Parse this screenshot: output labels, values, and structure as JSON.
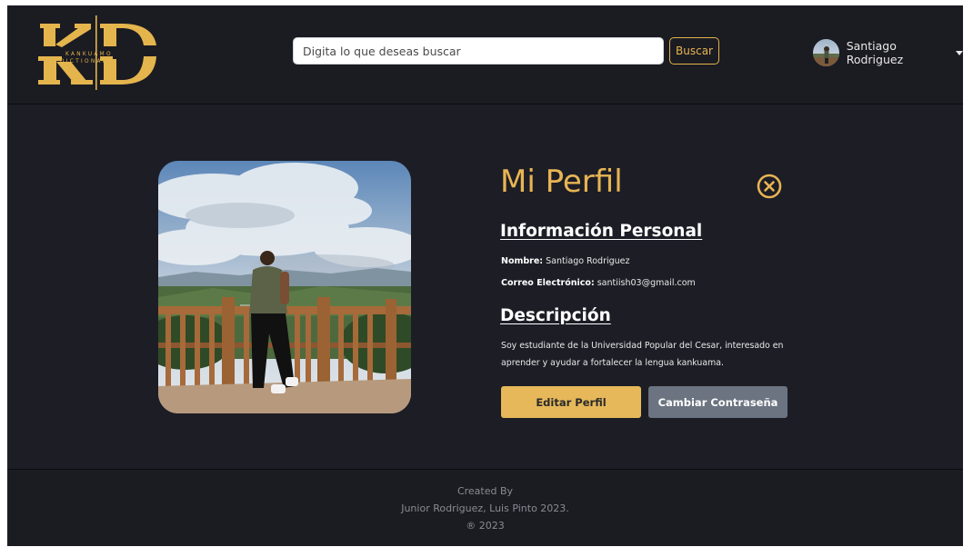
{
  "header": {
    "logo": {
      "top_text": "KANKUAMO",
      "bottom_text": "DICTIONARY",
      "monogram": "KD",
      "color": "#e4b54d"
    },
    "search": {
      "placeholder": "Digita lo que deseas buscar",
      "value": "",
      "button_label": "Buscar"
    },
    "user": {
      "name": "Santiago Rodriguez",
      "avatar_icon": "user-avatar-photo"
    }
  },
  "profile": {
    "title": "Mi Perfil",
    "close_icon": "close-circle-icon",
    "personal_info": {
      "heading": "Información Personal",
      "name_label": "Nombre:",
      "name_value": "Santiago Rodriguez",
      "email_label": "Correo Electrónico:",
      "email_value": "santiish03@gmail.com"
    },
    "description": {
      "heading": "Descripción",
      "text": "Soy estudiante de la Universidad Popular del Cesar, interesado en aprender y ayudar a fortalecer la lengua kankuama."
    },
    "buttons": {
      "edit": "Editar Perfil",
      "change_password": "Cambiar Contraseña"
    }
  },
  "footer": {
    "line1": "Created By",
    "line2": "Junior Rodriguez, Luis Pinto 2023.",
    "line3": "® 2023"
  },
  "colors": {
    "accent": "#e7b553",
    "background": "#1d1d26",
    "header_bg": "#1b1b22",
    "secondary_button": "#6b7480"
  }
}
